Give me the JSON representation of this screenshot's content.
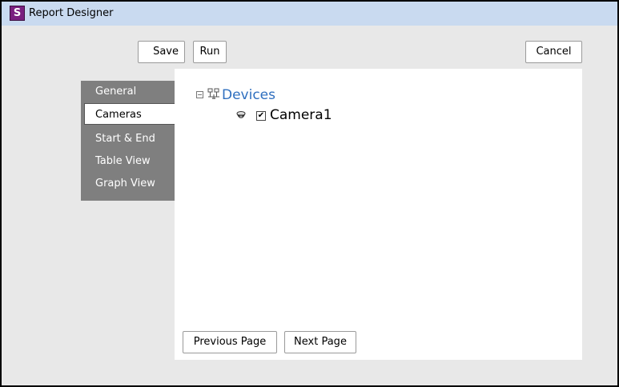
{
  "window": {
    "title": "Report Designer",
    "app_icon_letter": "S"
  },
  "toolbar": {
    "save_label": "Save",
    "run_label": "Run",
    "cancel_label": "Cancel"
  },
  "sidebar": {
    "items": [
      {
        "label": "General",
        "active": false
      },
      {
        "label": "Cameras",
        "active": true
      },
      {
        "label": "Start & End",
        "active": false
      },
      {
        "label": "Table View",
        "active": false
      },
      {
        "label": "Graph View",
        "active": false
      }
    ]
  },
  "tree": {
    "root_label": "Devices",
    "root_expanded": true,
    "children": [
      {
        "label": "Camera1",
        "checked": true
      }
    ]
  },
  "pagination": {
    "previous_label": "Previous Page",
    "next_label": "Next Page"
  },
  "colors": {
    "titlebar": "#c9daf0",
    "sidebar": "#7f7f7f",
    "link": "#2f6fbf",
    "window_bg": "#e8e8e8"
  }
}
